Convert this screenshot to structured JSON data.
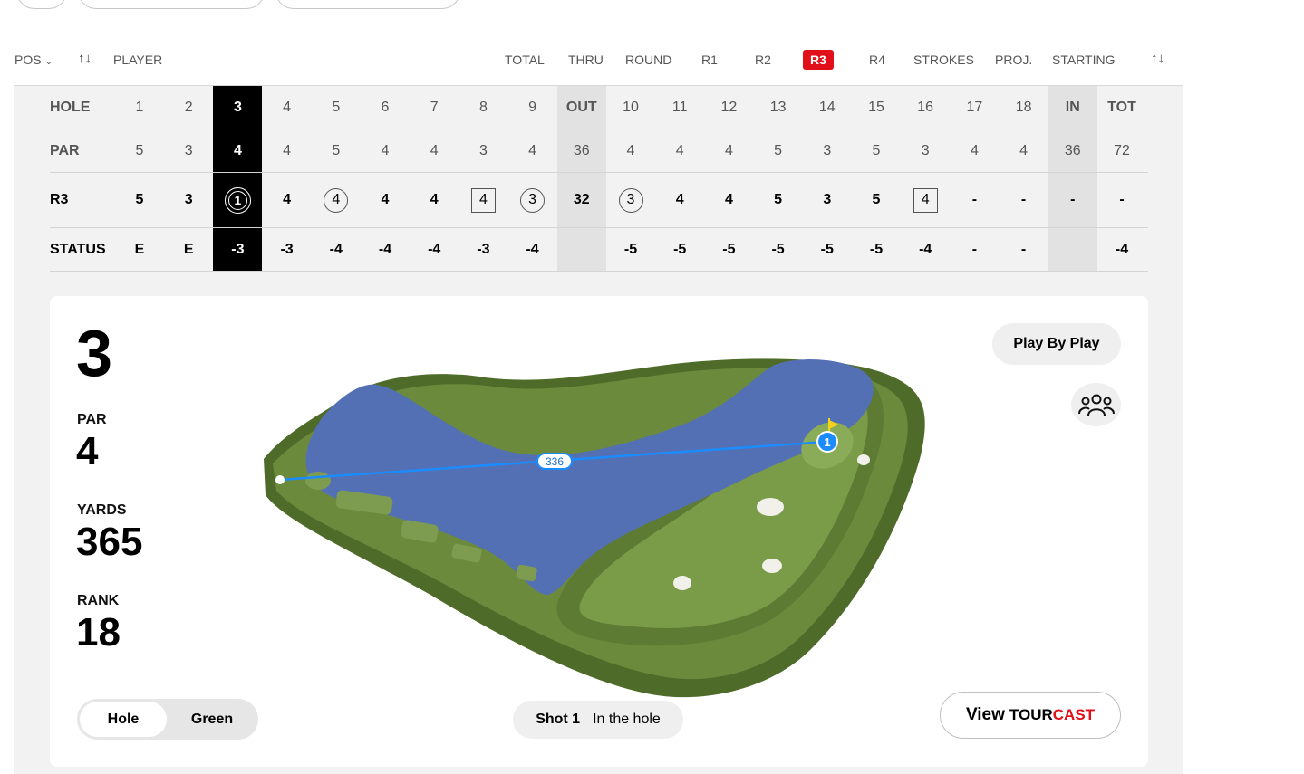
{
  "header": {
    "pos": "POS",
    "player": "PLAYER",
    "columns": [
      "TOTAL",
      "THRU",
      "ROUND",
      "R1",
      "R2",
      "R3",
      "R4",
      "STROKES",
      "PROJ.",
      "STARTING"
    ]
  },
  "scorecard": {
    "row_labels": {
      "hole": "HOLE",
      "par": "PAR",
      "round": "R3",
      "status": "STATUS"
    },
    "holes": [
      "1",
      "2",
      "3",
      "4",
      "5",
      "6",
      "7",
      "8",
      "9",
      "OUT",
      "10",
      "11",
      "12",
      "13",
      "14",
      "15",
      "16",
      "17",
      "18",
      "IN",
      "TOT"
    ],
    "par": [
      "5",
      "3",
      "4",
      "4",
      "5",
      "4",
      "4",
      "3",
      "4",
      "36",
      "4",
      "4",
      "4",
      "5",
      "3",
      "5",
      "3",
      "4",
      "4",
      "36",
      "72"
    ],
    "round": [
      "5",
      "3",
      "1",
      "4",
      "4",
      "4",
      "4",
      "4",
      "3",
      "32",
      "3",
      "4",
      "4",
      "5",
      "3",
      "5",
      "4",
      "-",
      "-",
      "-",
      "-"
    ],
    "status": [
      "E",
      "E",
      "-3",
      "-3",
      "-4",
      "-4",
      "-4",
      "-3",
      "-4",
      "",
      "-5",
      "-5",
      "-5",
      "-5",
      "-5",
      "-5",
      "-4",
      "-",
      "-",
      "",
      "-4"
    ],
    "round_marks": [
      "",
      "",
      "double-circle",
      "",
      "circle",
      "",
      "",
      "square",
      "circle",
      "",
      "circle",
      "",
      "",
      "",
      "",
      "",
      "square",
      "",
      "",
      "",
      ""
    ],
    "current_hole_index": 2,
    "shaded_columns": [
      9,
      19
    ]
  },
  "hole_card": {
    "hole_number": "3",
    "par_label": "PAR",
    "par_value": "4",
    "yards_label": "YARDS",
    "yards_value": "365",
    "rank_label": "RANK",
    "rank_value": "18",
    "play_by_play": "Play By Play",
    "toggle": {
      "hole": "Hole",
      "green": "Green",
      "selected": "Hole"
    },
    "shot": {
      "label": "Shot 1",
      "result": "In the hole"
    },
    "tourcast": {
      "view": "View",
      "tour": "TOUR",
      "cast": "CAST"
    },
    "shot_distance": "336",
    "shot_marker": "1",
    "icons": {
      "group": "group-icon",
      "flag": "flag-icon"
    }
  },
  "colors": {
    "accent_red": "#e10f1a",
    "water": "#5470b4",
    "fairway": "#6e8e3f",
    "rough": "#4e6a28",
    "shot_line": "#1a8cff"
  }
}
